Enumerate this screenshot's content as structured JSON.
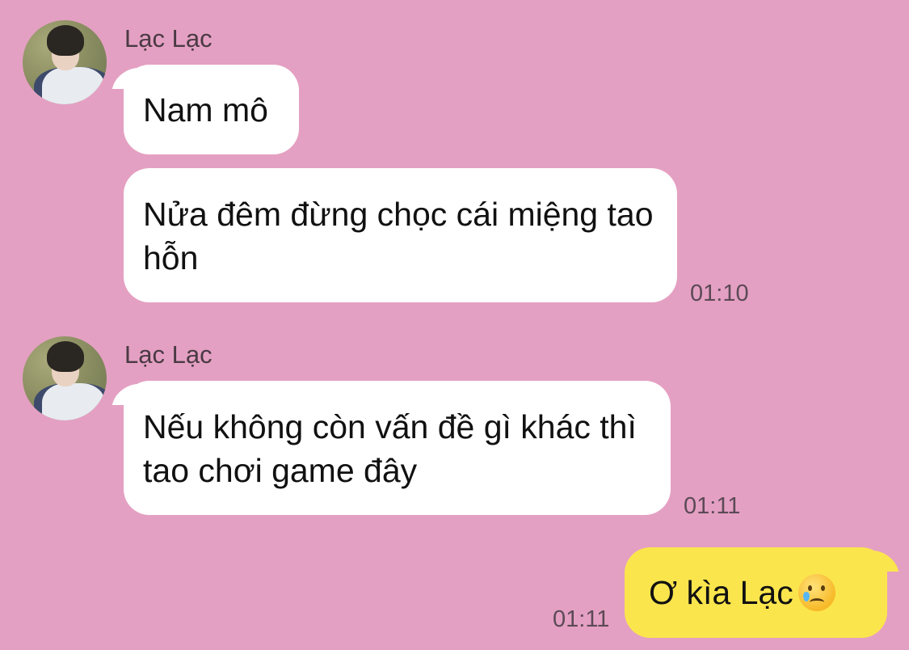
{
  "chat": {
    "groups": [
      {
        "sender": "Lạc Lạc",
        "messages": [
          "Nam mô",
          "Nửa đêm đừng chọc cái miệng tao hỗn"
        ],
        "time": "01:10"
      },
      {
        "sender": "Lạc Lạc",
        "messages": [
          "Nếu không còn vấn đề gì khác thì tao chơi game đây"
        ],
        "time": "01:11"
      }
    ],
    "outgoing": {
      "text": "Ơ kìa Lạc",
      "emoji": "crying-face",
      "time": "01:11"
    }
  },
  "colors": {
    "background": "#e4a0c2",
    "incoming_bubble": "#ffffff",
    "outgoing_bubble": "#fbe54d"
  }
}
